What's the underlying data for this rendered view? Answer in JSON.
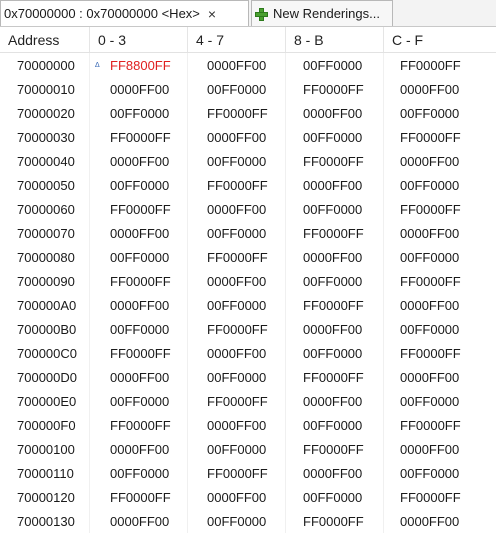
{
  "tabs": {
    "active_label": "0x70000000 : 0x70000000 <Hex>",
    "close_glyph": "×",
    "new_label": "New Renderings..."
  },
  "columns": [
    "Address",
    "0 - 3",
    "4 - 7",
    "8 - B",
    "C - F"
  ],
  "colors": {
    "changed_value": "#e02020",
    "new_rendering_icon": "#4aa030"
  },
  "changed_cell": {
    "row": 0,
    "col": 1,
    "marker": "Δ"
  },
  "rows": [
    [
      "70000000",
      "FF8800FF",
      "0000FF00",
      "00FF0000",
      "FF0000FF"
    ],
    [
      "70000010",
      "0000FF00",
      "00FF0000",
      "FF0000FF",
      "0000FF00"
    ],
    [
      "70000020",
      "00FF0000",
      "FF0000FF",
      "0000FF00",
      "00FF0000"
    ],
    [
      "70000030",
      "FF0000FF",
      "0000FF00",
      "00FF0000",
      "FF0000FF"
    ],
    [
      "70000040",
      "0000FF00",
      "00FF0000",
      "FF0000FF",
      "0000FF00"
    ],
    [
      "70000050",
      "00FF0000",
      "FF0000FF",
      "0000FF00",
      "00FF0000"
    ],
    [
      "70000060",
      "FF0000FF",
      "0000FF00",
      "00FF0000",
      "FF0000FF"
    ],
    [
      "70000070",
      "0000FF00",
      "00FF0000",
      "FF0000FF",
      "0000FF00"
    ],
    [
      "70000080",
      "00FF0000",
      "FF0000FF",
      "0000FF00",
      "00FF0000"
    ],
    [
      "70000090",
      "FF0000FF",
      "0000FF00",
      "00FF0000",
      "FF0000FF"
    ],
    [
      "700000A0",
      "0000FF00",
      "00FF0000",
      "FF0000FF",
      "0000FF00"
    ],
    [
      "700000B0",
      "00FF0000",
      "FF0000FF",
      "0000FF00",
      "00FF0000"
    ],
    [
      "700000C0",
      "FF0000FF",
      "0000FF00",
      "00FF0000",
      "FF0000FF"
    ],
    [
      "700000D0",
      "0000FF00",
      "00FF0000",
      "FF0000FF",
      "0000FF00"
    ],
    [
      "700000E0",
      "00FF0000",
      "FF0000FF",
      "0000FF00",
      "00FF0000"
    ],
    [
      "700000F0",
      "FF0000FF",
      "0000FF00",
      "00FF0000",
      "FF0000FF"
    ],
    [
      "70000100",
      "0000FF00",
      "00FF0000",
      "FF0000FF",
      "0000FF00"
    ],
    [
      "70000110",
      "00FF0000",
      "FF0000FF",
      "0000FF00",
      "00FF0000"
    ],
    [
      "70000120",
      "FF0000FF",
      "0000FF00",
      "00FF0000",
      "FF0000FF"
    ],
    [
      "70000130",
      "0000FF00",
      "00FF0000",
      "FF0000FF",
      "0000FF00"
    ]
  ]
}
